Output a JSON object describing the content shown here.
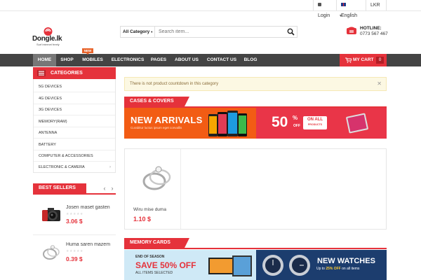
{
  "topbar": {
    "login": "Login",
    "language": "English",
    "currency": "LKR"
  },
  "header": {
    "logo_text": "Dongle.lk",
    "logo_tagline": "Surf internet freely",
    "search": {
      "category": "All Category",
      "placeholder": "Search item..."
    },
    "hotline": {
      "label": "HOTLINE:",
      "number": "0773 567 467"
    }
  },
  "nav": {
    "items": [
      {
        "label": "HOME",
        "active": true
      },
      {
        "label": "SHOP"
      },
      {
        "label": "MOBILES",
        "badge": "NEW"
      },
      {
        "label": "ELECTRONICS"
      },
      {
        "label": "PAGES"
      },
      {
        "label": "ABOUT US"
      },
      {
        "label": "CONTACT US"
      },
      {
        "label": "BLOG"
      }
    ],
    "cart": {
      "label": "MY CART",
      "count": "0"
    }
  },
  "sidebar": {
    "categories_title": "CATEGORIES",
    "categories": [
      "5G DEVICES",
      "4G DEVICES",
      "3G DEVICES",
      "MEMORY(RAM)",
      "ANTENNA",
      "BATTERY",
      "COMPUTER & ACCESSORIES",
      "ELECTRONIC & CAMERA"
    ],
    "best_sellers_title": "BEST SELLERS",
    "best_sellers": [
      {
        "name": "Josen maset gasten",
        "price": "3.06 $",
        "icon": "camera-icon"
      },
      {
        "name": "Huma saren mazem",
        "price": "0.39 $",
        "icon": "ring-icon"
      }
    ]
  },
  "main": {
    "notice": "There is not product countdown in this category",
    "section1_title": "CASES & COVERS",
    "banner1": {
      "title": "NEW ARRIVALS",
      "subtitle": "Curabitur luctus ipsum eget convallis",
      "percent": "50",
      "percent_sign": "%",
      "off": "OFF",
      "badge_line1": "ON ALL",
      "badge_line2": "PRODUCTS"
    },
    "product": {
      "name": "Wiru mise duma",
      "price": "1.10 $"
    },
    "section2_title": "MEMORY CARDS",
    "banner2": {
      "left_small": "END OF SEASON",
      "left_big": "SAVE 50% OFF",
      "left_sub": "ALL ITEMS SELECTED",
      "right_title": "NEW WATCHES",
      "right_sub_pre": "Up to",
      "right_sub_pct": "25% OFF",
      "right_sub_post": "on all items"
    }
  },
  "colors": {
    "accent": "#e5323b",
    "nav_bg": "#444444",
    "orange": "#f25c14"
  }
}
